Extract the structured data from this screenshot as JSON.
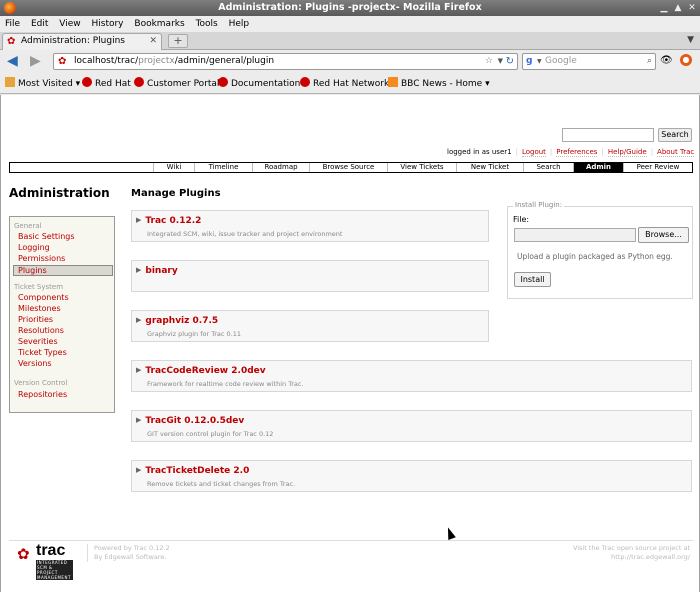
{
  "window": {
    "title": "Administration: Plugins -projectx- Mozilla Firefox"
  },
  "menu": [
    "File",
    "Edit",
    "View",
    "History",
    "Bookmarks",
    "Tools",
    "Help"
  ],
  "tab": {
    "title": "Administration: Plugins"
  },
  "url": {
    "host": "localhost/trac/",
    "project": "projectx",
    "path": "/admin/general/plugin"
  },
  "search_engine": {
    "placeholder": "Google"
  },
  "bookmarks": [
    "Most Visited",
    "Red Hat",
    "Customer Portal",
    "Documentation",
    "Red Hat Network",
    "BBC News - Home"
  ],
  "trac": {
    "search_button": "Search",
    "metanav": {
      "logged": "logged in as user1",
      "logout": "Logout",
      "preferences": "Preferences",
      "help": "Help/Guide",
      "about": "About Trac"
    },
    "mainnav": [
      "Wiki",
      "Timeline",
      "Roadmap",
      "Browse Source",
      "View Tickets",
      "New Ticket",
      "Search",
      "Admin",
      "Peer Review"
    ],
    "admin_title": "Administration",
    "page_title": "Manage Plugins",
    "sidebar": {
      "general": "General",
      "general_items": [
        "Basic Settings",
        "Logging",
        "Permissions",
        "Plugins"
      ],
      "ticket": "Ticket System",
      "ticket_items": [
        "Components",
        "Milestones",
        "Priorities",
        "Resolutions",
        "Severities",
        "Ticket Types",
        "Versions"
      ],
      "version": "Version Control",
      "version_items": [
        "Repositories"
      ]
    },
    "plugins": [
      {
        "name": "Trac 0.12.2",
        "desc": "Integrated SCM, wiki, issue tracker and project environment"
      },
      {
        "name": "binary",
        "desc": ""
      },
      {
        "name": "graphviz 0.7.5",
        "desc": "Graphviz plugin for Trac 0.11"
      },
      {
        "name": "TracCodeReview 2.0dev",
        "desc": "Framework for realtime code review within Trac."
      },
      {
        "name": "TracGit 0.12.0.5dev",
        "desc": "GIT version control plugin for Trac 0.12"
      },
      {
        "name": "TracTicketDelete 2.0",
        "desc": "Remove tickets and ticket changes from Trac."
      }
    ],
    "install": {
      "legend": "Install Plugin:",
      "file_label": "File:",
      "browse": "Browse...",
      "hint": "Upload a plugin packaged as Python egg.",
      "install_button": "Install"
    },
    "footer": {
      "logo": "trac",
      "logo_sub": "INTEGRATED SCM & PROJECT MANAGEMENT",
      "powered1": "Powered by Trac 0.12.2",
      "powered2": "By Edgewall Software.",
      "visit1": "Visit the Trac open source project at",
      "visit2": "http://trac.edgewall.org/"
    }
  }
}
